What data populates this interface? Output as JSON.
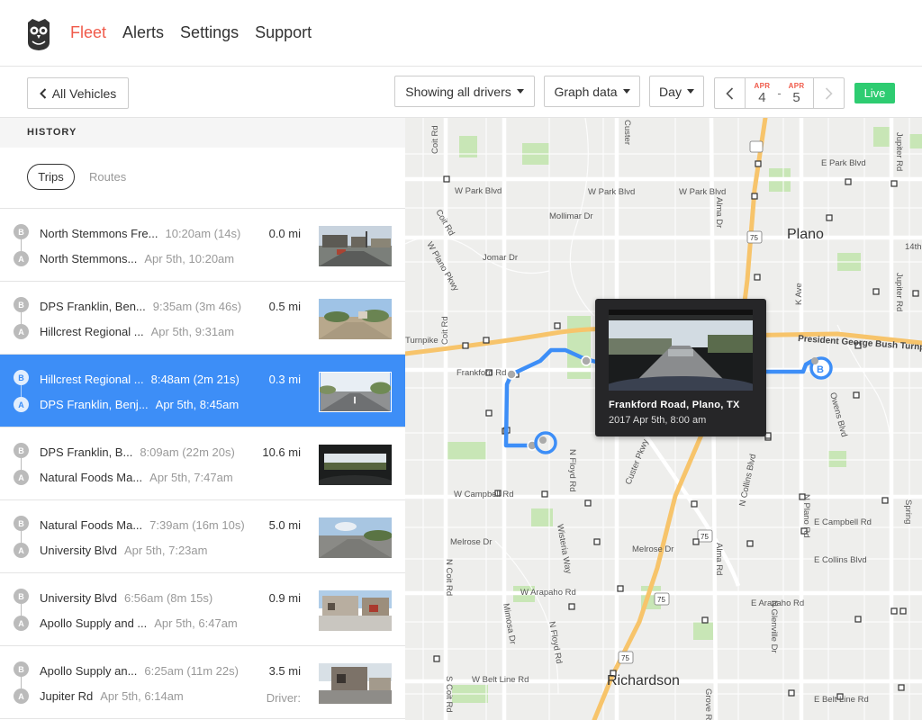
{
  "nav": {
    "items": [
      {
        "label": "Fleet",
        "active": true
      },
      {
        "label": "Alerts",
        "active": false
      },
      {
        "label": "Settings",
        "active": false
      },
      {
        "label": "Support",
        "active": false
      }
    ]
  },
  "toolbar": {
    "all_vehicles": "All Vehicles",
    "drivers_filter": "Showing all drivers",
    "graph_data": "Graph data",
    "period": "Day",
    "date_from": {
      "month": "APR",
      "day": "4"
    },
    "date_sep": "-",
    "date_to": {
      "month": "APR",
      "day": "5"
    },
    "live": "Live"
  },
  "sidebar": {
    "section_title": "HISTORY",
    "tabs": {
      "trips": "Trips",
      "routes": "Routes"
    },
    "trips": [
      {
        "dest": "North Stemmons Fre...",
        "dest_meta": "10:20am (14s)",
        "origin": "North Stemmons...",
        "origin_meta": "Apr 5th, 10:20am",
        "distance": "0.0 mi",
        "selected": false
      },
      {
        "dest": "DPS Franklin, Ben...",
        "dest_meta": "9:35am (3m 46s)",
        "origin": "Hillcrest Regional ...",
        "origin_meta": "Apr 5th, 9:31am",
        "distance": "0.5 mi",
        "selected": false
      },
      {
        "dest": "Hillcrest Regional ...",
        "dest_meta": "8:48am (2m 21s)",
        "origin": "DPS Franklin, Benj...",
        "origin_meta": "Apr 5th, 8:45am",
        "distance": "0.3 mi",
        "selected": true
      },
      {
        "dest": "DPS Franklin, B...",
        "dest_meta": "8:09am (22m 20s)",
        "origin": "Natural Foods Ma...",
        "origin_meta": "Apr 5th, 7:47am",
        "distance": "10.6 mi",
        "selected": false
      },
      {
        "dest": "Natural Foods Ma...",
        "dest_meta": "7:39am (16m 10s)",
        "origin": "University Blvd",
        "origin_meta": "Apr 5th, 7:23am",
        "distance": "5.0 mi",
        "selected": false
      },
      {
        "dest": "University Blvd",
        "dest_meta": "6:56am (8m 15s)",
        "origin": "Apollo Supply and ...",
        "origin_meta": "Apr 5th, 6:47am",
        "distance": "0.9 mi",
        "selected": false
      },
      {
        "dest": "Apollo Supply an...",
        "dest_meta": "6:25am (11m 22s)",
        "origin": "Jupiter Rd",
        "origin_meta": "Apr 5th, 6:14am",
        "distance": "3.5 mi",
        "driver": "Driver:",
        "selected": false
      }
    ],
    "marker_b": "B",
    "marker_a": "A"
  },
  "map": {
    "labels": {
      "plano": "Plano",
      "richardson": "Richardson",
      "turnpike": "Turnpike",
      "president_bush": "President George Bush Turnp",
      "frankford": "Frankford Rd",
      "w_park_blvd": "W Park Blvd",
      "w_park_blvd2": "W Park Blvd",
      "w_park_blvd3": "W Park Blvd",
      "e_park_blvd": "E Park Blvd",
      "mollimar": "Mollimar Dr",
      "jomar": "Jomar Dr",
      "w_campbell": "W Campbell Rd",
      "e_campbell": "E Campbell Rd",
      "melrose": "Melrose Dr",
      "mimosa": "Mimosa Dr",
      "w_arapaho": "W Arapaho Rd",
      "e_arapaho": "E Arapaho Rd",
      "e_collins": "E Collins Blvd",
      "n_collins": "N Collins Blvd",
      "w_belt": "W Belt Line Rd",
      "e_belt": "E Belt Line Rd",
      "owens": "Owens Blvd",
      "custer": "Custer Pkwy",
      "custer_top": "Custer",
      "alma": "Alma Dr",
      "alma2": "Alma Rd",
      "jupiter": "Jupiter Rd",
      "jupiter2": "Jupiter Rd",
      "n_coit": "N Coit Rd",
      "coit": "Coit Rd",
      "coit2": "Coit Rd",
      "coit3": "Coit Rd",
      "n_plano": "N Plano Rd",
      "n_glenville": "N Glenville Dr",
      "n_floyd": "N Floyd Rd",
      "wisteria": "Wisteria Way",
      "s_coit": "S Coit Rd",
      "grove": "Grove R",
      "k_ave": "K Ave",
      "fourteenth": "14th",
      "spring": "Spring",
      "w_plano_pkwy": "W Plano Pkwy",
      "hwy75": "75",
      "marker_b": "B"
    }
  },
  "popup": {
    "title": "Frankford Road, Plano, TX",
    "date": "2017 Apr 5th, 8:00 am"
  },
  "colors": {
    "accent": "#f05a4a",
    "selected": "#3d8ef7",
    "live": "#2ecc71",
    "route": "#3d8ef7",
    "highway": "#f7c46b"
  }
}
